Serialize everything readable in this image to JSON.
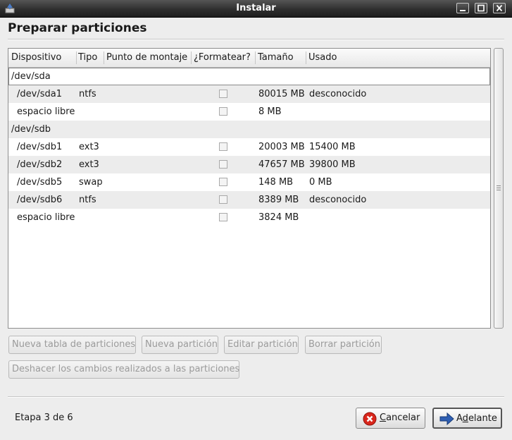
{
  "window": {
    "title": "Instalar"
  },
  "page": {
    "title": "Preparar particiones",
    "step": "Etapa 3 de 6"
  },
  "table": {
    "columns": [
      "Dispositivo",
      "Tipo",
      "Punto de montaje",
      "¿Formatear?",
      "Tamaño",
      "Usado"
    ],
    "rows": [
      {
        "device": "/dev/sda",
        "type": "",
        "mount": "",
        "format": null,
        "size": "",
        "used": "",
        "disk": true
      },
      {
        "device": "/dev/sda1",
        "type": "ntfs",
        "mount": "",
        "format": false,
        "size": "80015 MB",
        "used": "desconocido",
        "disk": false
      },
      {
        "device": "espacio libre",
        "type": "",
        "mount": "",
        "format": false,
        "size": "8 MB",
        "used": "",
        "disk": false
      },
      {
        "device": "/dev/sdb",
        "type": "",
        "mount": "",
        "format": null,
        "size": "",
        "used": "",
        "disk": true
      },
      {
        "device": "/dev/sdb1",
        "type": "ext3",
        "mount": "",
        "format": false,
        "size": "20003 MB",
        "used": "15400 MB",
        "disk": false
      },
      {
        "device": "/dev/sdb2",
        "type": "ext3",
        "mount": "",
        "format": false,
        "size": "47657 MB",
        "used": "39800 MB",
        "disk": false
      },
      {
        "device": "/dev/sdb5",
        "type": "swap",
        "mount": "",
        "format": false,
        "size": "148 MB",
        "used": "0 MB",
        "disk": false
      },
      {
        "device": "/dev/sdb6",
        "type": "ntfs",
        "mount": "",
        "format": false,
        "size": "8389 MB",
        "used": "desconocido",
        "disk": false
      },
      {
        "device": "espacio libre",
        "type": "",
        "mount": "",
        "format": false,
        "size": "3824 MB",
        "used": "",
        "disk": false
      }
    ]
  },
  "actions": {
    "new_table": "Nueva tabla de particiones",
    "new_partition": "Nueva partición",
    "edit_partition": "Editar partición",
    "delete_partition": "Borrar partición",
    "undo_changes": "Deshacer los cambios realizados a las particiones"
  },
  "buttons": {
    "cancel": "Cancelar",
    "cancel_mnemonic": "C",
    "cancel_rest": "ancelar",
    "forward_pre": "A",
    "forward_mnemonic": "d",
    "forward_rest": "elante"
  },
  "icons": {
    "app": "installer-icon",
    "minimize": "minimize-icon",
    "maximize": "maximize-icon",
    "close": "close-icon",
    "cancel": "cancel-icon",
    "forward": "forward-arrow-icon"
  },
  "colors": {
    "cancel_red": "#d9261c",
    "forward_blue": "#2f5fb3"
  }
}
